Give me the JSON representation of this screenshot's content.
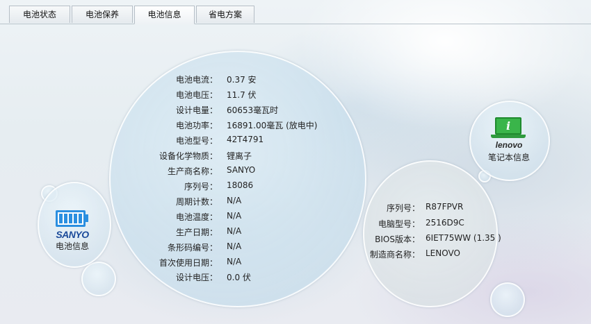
{
  "tabs": [
    {
      "label": "电池状态",
      "active": false
    },
    {
      "label": "电池保养",
      "active": false
    },
    {
      "label": "电池信息",
      "active": true
    },
    {
      "label": "省电方案",
      "active": false
    }
  ],
  "battery_info": {
    "rows": [
      {
        "label": "电池电流：",
        "value": "0.37 安"
      },
      {
        "label": "电池电压：",
        "value": "11.7 伏"
      },
      {
        "label": "设计电量：",
        "value": "60653毫瓦时"
      },
      {
        "label": "电池功率：",
        "value": "16891.00毫瓦 (放电中)"
      },
      {
        "label": "电池型号：",
        "value": "42T4791"
      },
      {
        "label": "设备化学物质：",
        "value": "锂离子"
      },
      {
        "label": "生产商名称：",
        "value": "SANYO"
      },
      {
        "label": "序列号：",
        "value": "18086"
      },
      {
        "label": "周期计数：",
        "value": "N/A"
      },
      {
        "label": "电池温度：",
        "value": "N/A"
      },
      {
        "label": "生产日期：",
        "value": "N/A"
      },
      {
        "label": "条形码编号：",
        "value": "N/A"
      },
      {
        "label": "首次使用日期：",
        "value": "N/A"
      },
      {
        "label": "设计电压：",
        "value": "0.0 伏"
      }
    ]
  },
  "notebook_info": {
    "rows": [
      {
        "label": "序列号：",
        "value": "R87FPVR"
      },
      {
        "label": "电脑型号：",
        "value": "2516D9C"
      },
      {
        "label": "BIOS版本：",
        "value": "6IET75WW (1.35 )"
      },
      {
        "label": "制造商名称：",
        "value": "LENOVO"
      }
    ]
  },
  "battery_bubble": {
    "logo_text": "SANYO",
    "caption": "电池信息",
    "icon": "battery-icon",
    "icon_color": "#2b8fe0"
  },
  "lenovo_bubble": {
    "logo_text": "lenovo",
    "icon_glyph": "i",
    "caption": "笔记本信息",
    "icon": "laptop-info-icon",
    "icon_color": "#3ab54a"
  }
}
